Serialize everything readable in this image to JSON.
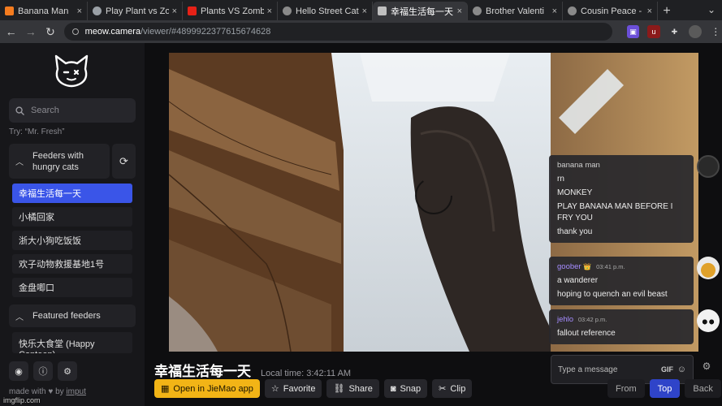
{
  "browser": {
    "tabs": [
      {
        "title": "Banana Man",
        "favicon_color": "#f57c1f"
      },
      {
        "title": "Play Plant vs Zo",
        "favicon_color": "#9aa0a6"
      },
      {
        "title": "Plants VS Zomb",
        "favicon_color": "#e62117"
      },
      {
        "title": "Hello Street Cat",
        "favicon_color": "#8a8a8a"
      },
      {
        "title": "幸福生活每一天",
        "favicon_color": "#bfbfbf",
        "active": true
      },
      {
        "title": "Brother Valenti",
        "favicon_color": "#8a8a8a"
      },
      {
        "title": "Cousin Peace -",
        "favicon_color": "#8a8a8a"
      }
    ],
    "close_glyph": "×",
    "newtab_glyph": "+",
    "menu_caret": "⌄",
    "url_host": "meow.camera",
    "url_path": "/viewer/#4899922377615674628"
  },
  "sidebar": {
    "search_placeholder": "Search",
    "try_hint": "Try: “Mr. Fresh”",
    "group_hungry": "Feeders with hungry cats",
    "hungry_feeders": [
      "幸福生活每一天",
      "小橘回家",
      "浙大小狗吃饭饭",
      "欢子动物救援基地1号",
      "金盘唧口"
    ],
    "group_featured": "Featured feeders",
    "featured_feeders": [
      "快乐大食堂 (Happy Canteen)"
    ],
    "made_with": "made with",
    "by": "by",
    "maker": "imput"
  },
  "stream": {
    "title": "幸福生活每一天",
    "local_time_label": "Local time: 3:42:11 AM"
  },
  "actions": {
    "open_app": "Open in JieMao app",
    "favorite": "Favorite",
    "share": "Share",
    "snap": "Snap",
    "clip": "Clip"
  },
  "chat": {
    "messages": [
      {
        "user": "banana man",
        "time": "",
        "lines": [
          "rn",
          "MONKEY",
          "PLAY BANANA MAN BEFORE I FRY YOU",
          "thank you"
        ],
        "user_color": "#cfcfcf"
      },
      {
        "user": "goober",
        "time": "03:41 p.m.",
        "lines": [
          "a wanderer",
          "hoping to quench an evil beast"
        ],
        "user_color": "#a58cff",
        "badge": "👑"
      },
      {
        "user": "jehlo",
        "time": "03:42 p.m.",
        "lines": [
          "fallout reference"
        ],
        "user_color": "#a58cff"
      }
    ],
    "input_placeholder": "Type a message",
    "gif_label": "GIF",
    "tab_from": "From",
    "tab_top": "Top",
    "tab_back": "Back"
  },
  "watermark": "imgflip.com",
  "colors": {
    "accent_blue": "#3a55e8",
    "primary_yellow": "#f2b416"
  }
}
